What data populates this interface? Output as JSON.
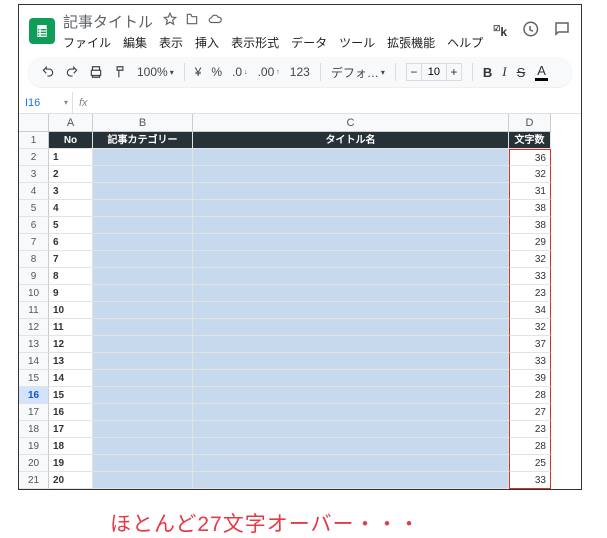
{
  "doc": {
    "title": "記事タイトル"
  },
  "menu": {
    "file": "ファイル",
    "edit": "編集",
    "view": "表示",
    "insert": "挿入",
    "format": "表示形式",
    "data": "データ",
    "tools": "ツール",
    "ext": "拡張機能",
    "help": "ヘルプ"
  },
  "header": {
    "ext_label": "k"
  },
  "toolbar": {
    "zoom": "100%",
    "currency": "¥",
    "percent": "%",
    "dec_dec": ".0",
    "dec_inc": ".00",
    "numfmt": "123",
    "font": "デフォ…",
    "font_size": "10"
  },
  "namebox": {
    "cell": "I16",
    "fx": "fx"
  },
  "columns": {
    "A": "A",
    "B": "B",
    "C": "C",
    "D": "D"
  },
  "table_header": {
    "no": "No",
    "cat": "記事カテゴリー",
    "title": "タイトル名",
    "chars": "文字数"
  },
  "rows": [
    {
      "rh": "1"
    },
    {
      "rh": "2",
      "no": "1",
      "chars": "36"
    },
    {
      "rh": "3",
      "no": "2",
      "chars": "32"
    },
    {
      "rh": "4",
      "no": "3",
      "chars": "31"
    },
    {
      "rh": "5",
      "no": "4",
      "chars": "38"
    },
    {
      "rh": "6",
      "no": "5",
      "chars": "38"
    },
    {
      "rh": "7",
      "no": "6",
      "chars": "29"
    },
    {
      "rh": "8",
      "no": "7",
      "chars": "32"
    },
    {
      "rh": "9",
      "no": "8",
      "chars": "33"
    },
    {
      "rh": "10",
      "no": "9",
      "chars": "23"
    },
    {
      "rh": "11",
      "no": "10",
      "chars": "34"
    },
    {
      "rh": "12",
      "no": "11",
      "chars": "32"
    },
    {
      "rh": "13",
      "no": "12",
      "chars": "37"
    },
    {
      "rh": "14",
      "no": "13",
      "chars": "33"
    },
    {
      "rh": "15",
      "no": "14",
      "chars": "39"
    },
    {
      "rh": "16",
      "no": "15",
      "chars": "28"
    },
    {
      "rh": "17",
      "no": "16",
      "chars": "27"
    },
    {
      "rh": "18",
      "no": "17",
      "chars": "23"
    },
    {
      "rh": "19",
      "no": "18",
      "chars": "28"
    },
    {
      "rh": "20",
      "no": "19",
      "chars": "25"
    },
    {
      "rh": "21",
      "no": "20",
      "chars": "33"
    }
  ],
  "caption": "ほとんど27文字オーバー・・・"
}
